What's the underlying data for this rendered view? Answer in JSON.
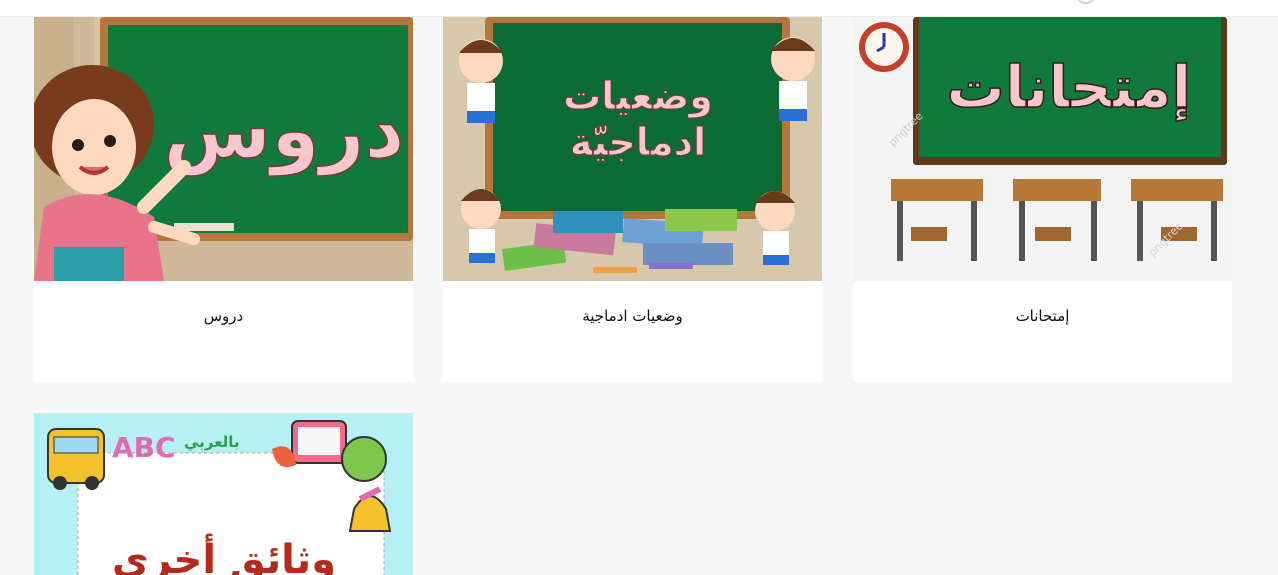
{
  "cards": [
    {
      "caption": "دروس",
      "board_text": "دروس"
    },
    {
      "caption": "وضعيات ادماجية",
      "board_line1": "وضعيات",
      "board_line2": "ادماجيّة"
    },
    {
      "caption": "إمتحانات",
      "board_text": "إمتحانات",
      "watermark": "pngtree"
    },
    {
      "caption": "وثائق أخرى",
      "board_text": "وثائق أخرى",
      "logo_text": "بالعربي"
    }
  ],
  "colors": {
    "board_green": "#0f7a3c",
    "board_frame": "#b5763c",
    "board_text_pink": "#f7c6cf",
    "card_bg": "#ffffff",
    "page_bg": "#f7f7f7"
  }
}
